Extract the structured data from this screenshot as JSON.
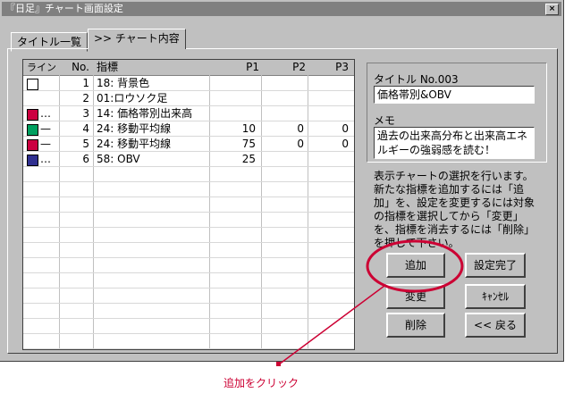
{
  "window": {
    "title": "『日足』チャート画面設定",
    "close": "×"
  },
  "tabs": [
    {
      "label": "タイトル一覧"
    },
    {
      "label": ">> チャート内容"
    }
  ],
  "grid": {
    "headers": [
      "ライン",
      "No.",
      "指標",
      "P1",
      "P2",
      "P3"
    ],
    "rows": [
      {
        "swatch_color": "#ffffff",
        "swatch_border": "#000000",
        "line": "",
        "no": "1",
        "indicator": "18: 背景色",
        "p1": "",
        "p2": "",
        "p3": ""
      },
      {
        "swatch_color": "",
        "swatch_border": "",
        "line": "",
        "no": "2",
        "indicator": "01:ロウソク足",
        "p1": "",
        "p2": "",
        "p3": ""
      },
      {
        "swatch_color": "#cc0040",
        "swatch_border": "#000000",
        "line": "…",
        "no": "3",
        "indicator": "14: 価格帯別出来高",
        "p1": "",
        "p2": "",
        "p3": ""
      },
      {
        "swatch_color": "#00a060",
        "swatch_border": "#000000",
        "line": "—",
        "no": "4",
        "indicator": "24: 移動平均線",
        "p1": "10",
        "p2": "0",
        "p3": "0"
      },
      {
        "swatch_color": "#cc0040",
        "swatch_border": "#000000",
        "line": "—",
        "no": "5",
        "indicator": "24: 移動平均線",
        "p1": "75",
        "p2": "0",
        "p3": "0"
      },
      {
        "swatch_color": "#303090",
        "swatch_border": "#000000",
        "line": "…",
        "no": "6",
        "indicator": "58: OBV",
        "p1": "25",
        "p2": "",
        "p3": ""
      }
    ]
  },
  "title_field": {
    "label": "タイトル No.003",
    "value": "価格帯別&OBV"
  },
  "memo_field": {
    "label": "メモ",
    "value": "過去の出来高分布と出来高エネルギーの強弱感を読む！"
  },
  "help_text": "表示チャートの選択を行います。新たな指標を追加するには「追加」を、設定を変更するには対象の指標を選択してから「変更」を、指標を消去するには「削除」を押して下さい。",
  "buttons": {
    "add": "追加",
    "change": "変更",
    "delete": "削除",
    "done": "設定完了",
    "cancel": "ｷｬﾝｾﾙ",
    "back": "<< 戻る"
  },
  "annotation": {
    "text": "追加をクリック",
    "color": "#cc0033"
  }
}
